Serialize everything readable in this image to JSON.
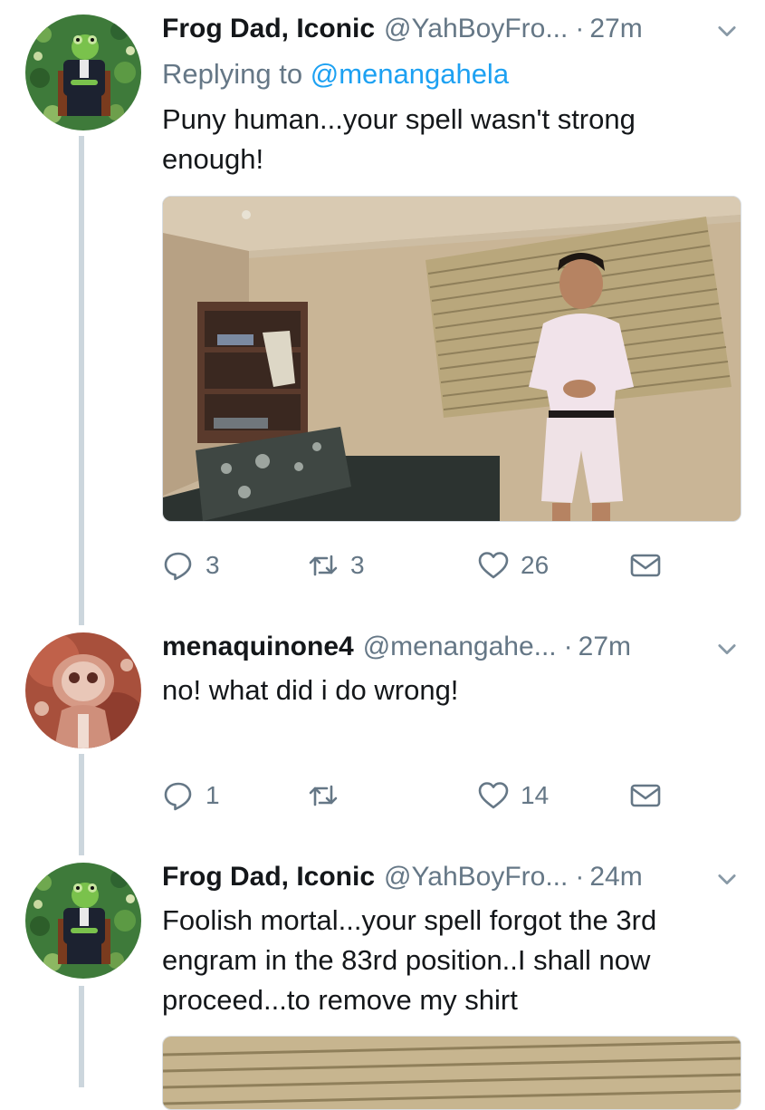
{
  "tweets": [
    {
      "name": "Frog Dad, Iconic",
      "handle": "@YahBoyFro...",
      "dot": "·",
      "time": "27m",
      "reply_prefix": "Replying to ",
      "reply_handle": "@menangahela",
      "text": "Puny human...your spell wasn't strong enough!",
      "replies": "3",
      "retweets": "3",
      "likes": "26"
    },
    {
      "name": "menaquinone4",
      "handle": "@menangahe...",
      "dot": "·",
      "time": "27m",
      "text": "no! what did i do wrong!",
      "replies": "1",
      "retweets": "",
      "likes": "14"
    },
    {
      "name": "Frog Dad, Iconic",
      "handle": "@YahBoyFro...",
      "dot": "·",
      "time": "24m",
      "text": "Foolish mortal...your spell forgot the 3rd engram in the 83rd position..I shall now proceed...to remove my shirt"
    }
  ],
  "icons": [
    "reply-icon",
    "retweet-icon",
    "like-icon",
    "direct-message-icon",
    "chevron-down-icon"
  ],
  "colors": {
    "name": "#14171a",
    "meta": "#657786",
    "mention": "#1da1f2",
    "thread_line": "#ccd6dd"
  }
}
